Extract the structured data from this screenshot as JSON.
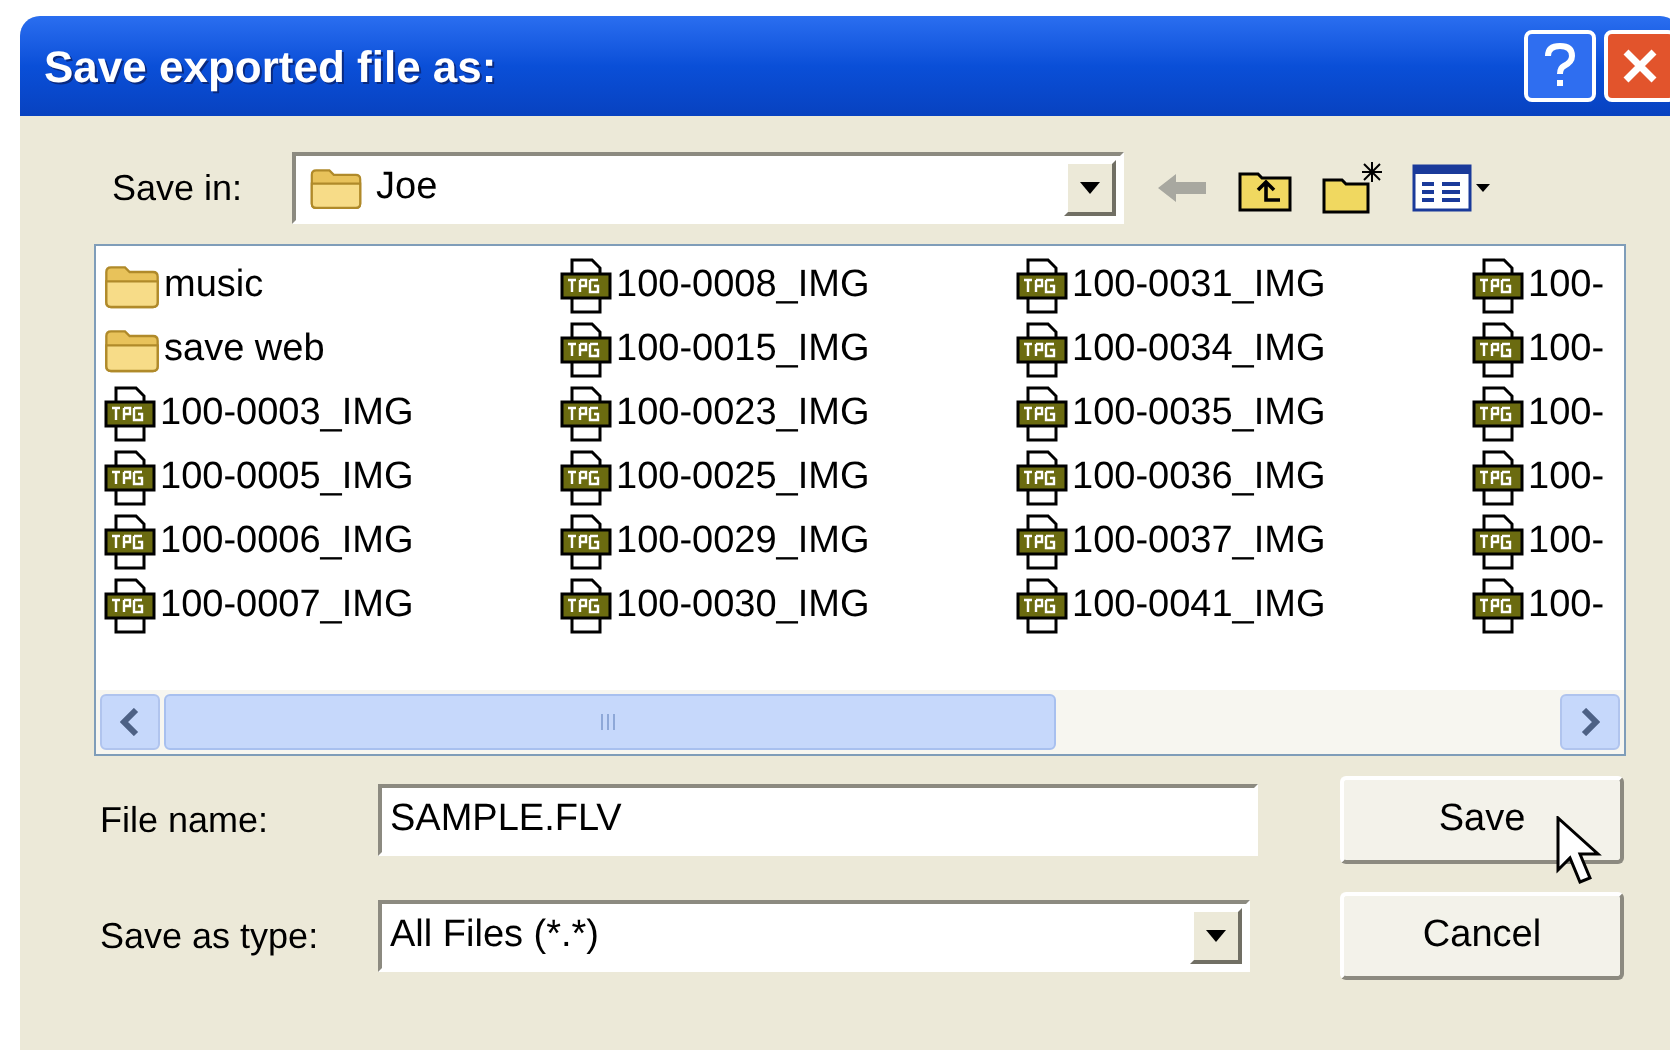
{
  "window": {
    "title": "Save exported file as:"
  },
  "save_in": {
    "label": "Save in:",
    "value": "Joe"
  },
  "files": [
    {
      "name": "music",
      "kind": "folder"
    },
    {
      "name": "save web",
      "kind": "folder"
    },
    {
      "name": "100-0003_IMG",
      "kind": "jpg"
    },
    {
      "name": "100-0005_IMG",
      "kind": "jpg"
    },
    {
      "name": "100-0006_IMG",
      "kind": "jpg"
    },
    {
      "name": "100-0007_IMG",
      "kind": "jpg"
    },
    {
      "name": "100-0008_IMG",
      "kind": "jpg"
    },
    {
      "name": "100-0015_IMG",
      "kind": "jpg"
    },
    {
      "name": "100-0023_IMG",
      "kind": "jpg"
    },
    {
      "name": "100-0025_IMG",
      "kind": "jpg"
    },
    {
      "name": "100-0029_IMG",
      "kind": "jpg"
    },
    {
      "name": "100-0030_IMG",
      "kind": "jpg"
    },
    {
      "name": "100-0031_IMG",
      "kind": "jpg"
    },
    {
      "name": "100-0034_IMG",
      "kind": "jpg"
    },
    {
      "name": "100-0035_IMG",
      "kind": "jpg"
    },
    {
      "name": "100-0036_IMG",
      "kind": "jpg"
    },
    {
      "name": "100-0037_IMG",
      "kind": "jpg"
    },
    {
      "name": "100-0041_IMG",
      "kind": "jpg"
    },
    {
      "name": "100-",
      "kind": "jpg"
    },
    {
      "name": "100-",
      "kind": "jpg"
    },
    {
      "name": "100-",
      "kind": "jpg"
    },
    {
      "name": "100-",
      "kind": "jpg"
    },
    {
      "name": "100-",
      "kind": "jpg"
    },
    {
      "name": "100-",
      "kind": "jpg"
    }
  ],
  "file_name": {
    "label": "File name:",
    "value": "SAMPLE.FLV"
  },
  "save_as_type": {
    "label": "Save as type:",
    "value": "All Files (*.*)"
  },
  "buttons": [
    "Save",
    "Cancel"
  ]
}
